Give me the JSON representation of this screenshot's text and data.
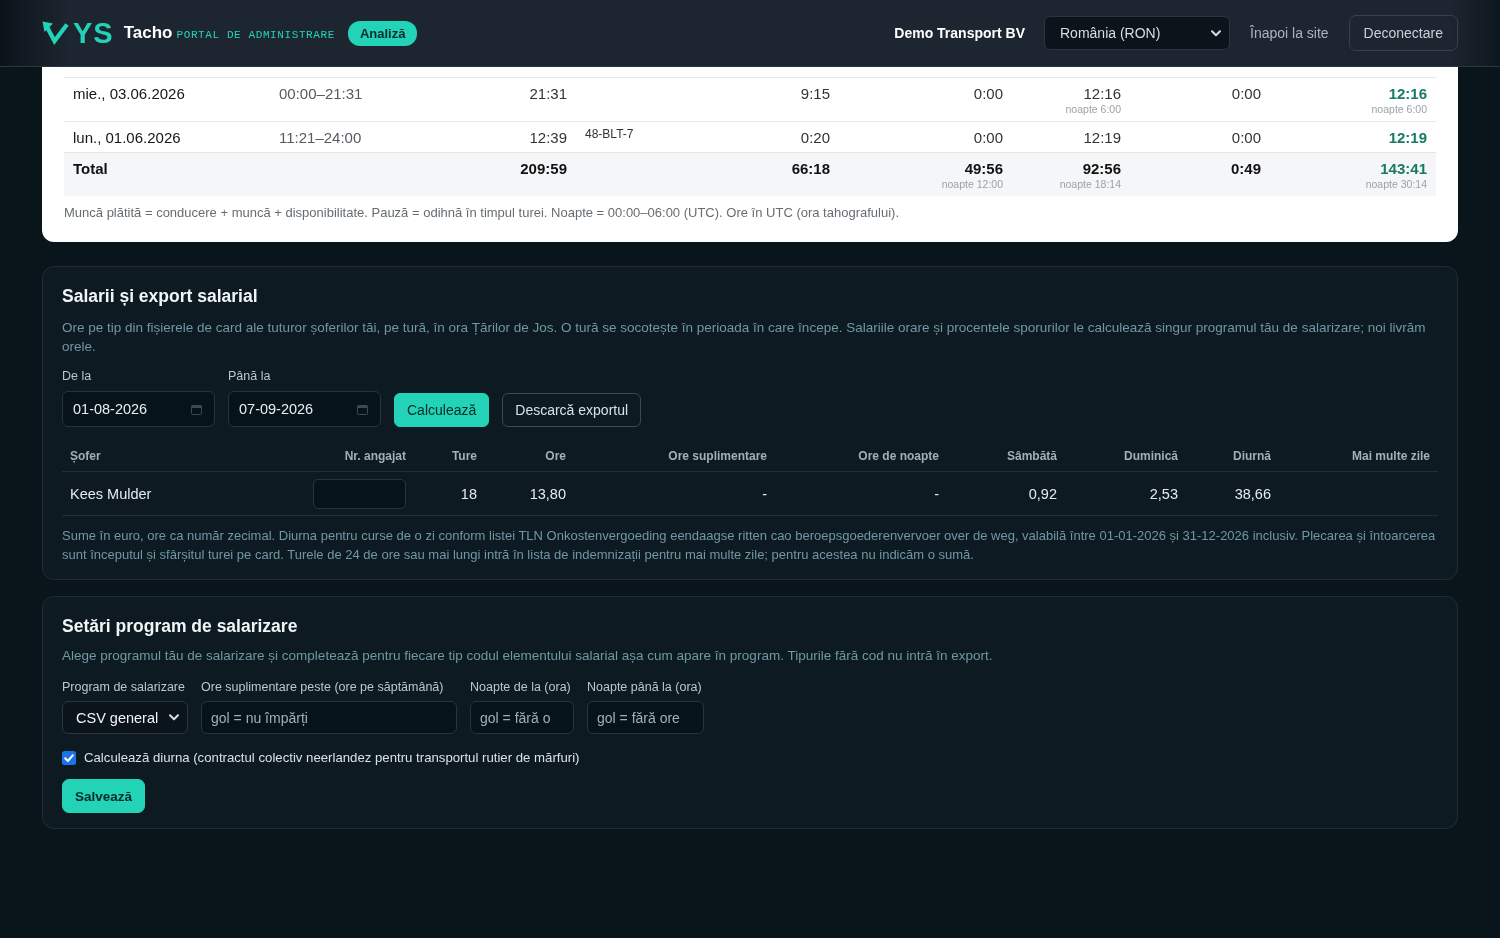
{
  "header": {
    "brand_mark": "YS",
    "brand_name": "Tacho",
    "tagline": "PORTAL DE ADMINISTRARE",
    "badge": "Analiză",
    "company": "Demo Transport BV",
    "region_select": {
      "value": "România (RON)"
    },
    "back_link": "Înapoi la site",
    "logout_button": "Deconectare"
  },
  "shift_table": {
    "columns": [
      {
        "kind": "label"
      },
      {
        "kind": "span"
      },
      {
        "kind": "number"
      },
      {
        "kind": "plate"
      },
      {
        "kind": "number"
      },
      {
        "kind": "number"
      },
      {
        "kind": "number"
      },
      {
        "kind": "number"
      },
      {
        "kind": "highlight"
      }
    ],
    "rows": [
      {
        "cells": [
          {
            "text": "mie., 03.06.2026"
          },
          {
            "text": "00:00–21:31"
          },
          {
            "text": "21:31"
          },
          null,
          {
            "text": "9:15"
          },
          {
            "text": "0:00"
          },
          {
            "text": "12:16",
            "note": "noapte 6:00"
          },
          {
            "text": "0:00"
          },
          {
            "text": "12:16",
            "note": "noapte 6:00"
          }
        ]
      },
      {
        "cells": [
          {
            "text": "lun., 01.06.2026"
          },
          {
            "text": "11:21–24:00"
          },
          {
            "text": "12:39"
          },
          {
            "text": "48-BLT-7"
          },
          {
            "text": "0:20"
          },
          {
            "text": "0:00"
          },
          {
            "text": "12:19"
          },
          {
            "text": "0:00"
          },
          {
            "text": "12:19"
          }
        ]
      }
    ],
    "total": {
      "cells": [
        {
          "text": "Total"
        },
        null,
        {
          "text": "209:59"
        },
        null,
        {
          "text": "66:18"
        },
        {
          "text": "49:56",
          "note": "noapte 12:00"
        },
        {
          "text": "92:56",
          "note": "noapte 18:14"
        },
        {
          "text": "0:49"
        },
        {
          "text": "143:41",
          "note": "noapte 30:14"
        }
      ]
    },
    "footnote": "Muncă plătită = conducere + muncă + disponibilitate. Pauză = odihnă în timpul turei. Noapte = 00:00–06:00 (UTC). Ore în UTC (ora tahografului)."
  },
  "salary_export": {
    "title": "Salarii și export salarial",
    "description": "Ore pe tip din fișierele de card ale tuturor șoferilor tăi, pe tură, în ora Țărilor de Jos. O tură se socotește în perioada în care începe. Salariile orare și procentele sporurilor le calculează singur programul tău de salarizare; noi livrăm orele.",
    "date_fields": [
      {
        "label": "De la",
        "value": "01-08-2026"
      },
      {
        "label": "Până la",
        "value": "07-09-2026"
      }
    ],
    "buttons": [
      {
        "kind": "primary",
        "label": "Calculează"
      },
      {
        "kind": "secondary",
        "label": "Descarcă exportul"
      }
    ],
    "table": {
      "columns": [
        {
          "label": "Șofer",
          "kind": "text"
        },
        {
          "label": "Nr. angajat",
          "kind": "input"
        },
        {
          "label": "Ture",
          "kind": "number"
        },
        {
          "label": "Ore",
          "kind": "number"
        },
        {
          "label": "Ore suplimentare",
          "kind": "number"
        },
        {
          "label": "Ore de noapte",
          "kind": "number"
        },
        {
          "label": "Sâmbătă",
          "kind": "number"
        },
        {
          "label": "Duminică",
          "kind": "number"
        },
        {
          "label": "Diurnă",
          "kind": "number"
        },
        {
          "label": "Mai multe zile",
          "kind": "number"
        }
      ],
      "rows": [
        {
          "cells": [
            "Kees Mulder",
            null,
            "18",
            "13,80",
            "-",
            "-",
            "0,92",
            "2,53",
            "38,66",
            null
          ]
        }
      ]
    },
    "footnote": "Sume în euro, ore ca număr zecimal. Diurna pentru curse de o zi conform listei TLN Onkostenvergoeding eendaagse ritten cao beroepsgoederenvervoer over de weg, valabilă între 01-01-2026 și 31-12-2026 inclusiv. Plecarea și întoarcerea sunt începutul și sfârșitul turei pe card. Turele de 24 de ore sau mai lungi intră în lista de indemnizații pentru mai multe zile; pentru acestea nu indicăm o sumă."
  },
  "payroll_settings": {
    "title": "Setări program de salarizare",
    "description": "Alege programul tău de salarizare și completează pentru fiecare tip codul elementului salarial așa cum apare în program. Tipurile fără cod nu intră în export.",
    "fields": [
      {
        "kind": "select",
        "label": "Program de salarizare",
        "value": "CSV general"
      },
      {
        "kind": "input",
        "label": "Ore suplimentare peste (ore pe săptămână)",
        "placeholder": "gol = nu împărți"
      },
      {
        "kind": "input",
        "label": "Noapte de la (ora)",
        "placeholder": "gol = fără o"
      },
      {
        "kind": "input",
        "label": "Noapte până la (ora)",
        "placeholder": "gol = fără ore"
      }
    ],
    "per_diem": {
      "label": "Calculează diurna (contractul colectiv neerlandez pentru transportul rutier de mărfuri)",
      "checked": true
    },
    "save_button": "Salvează"
  }
}
